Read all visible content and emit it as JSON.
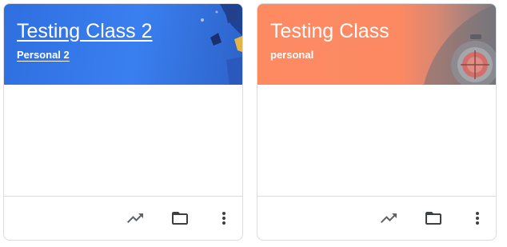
{
  "classes": [
    {
      "title": "Testing Class 2",
      "subtitle": "Personal 2",
      "theme_color": "#3a7ff0",
      "actions": [
        "trending-up-icon",
        "folder-icon",
        "more-vert-icon"
      ]
    },
    {
      "title": "Testing Class",
      "subtitle": "personal",
      "theme_color": "#fe8a62",
      "actions": [
        "trending-up-icon",
        "folder-icon",
        "more-vert-icon"
      ]
    }
  ]
}
